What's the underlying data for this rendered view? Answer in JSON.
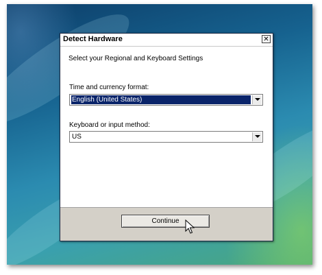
{
  "dialog": {
    "title": "Detect Hardware",
    "close_label": "✕",
    "heading": "Select your Regional and Keyboard Settings",
    "time_currency": {
      "label": "Time and currency format:",
      "value": "English (United States)"
    },
    "keyboard": {
      "label": "Keyboard or input method:",
      "value": "US"
    },
    "continue_label": "Continue"
  },
  "icons": {
    "close": "close-icon",
    "dropdown": "chevron-down-icon",
    "cursor": "mouse-pointer-icon"
  },
  "colors": {
    "selection": "#0a246a",
    "footer": "#d4d0c8"
  }
}
